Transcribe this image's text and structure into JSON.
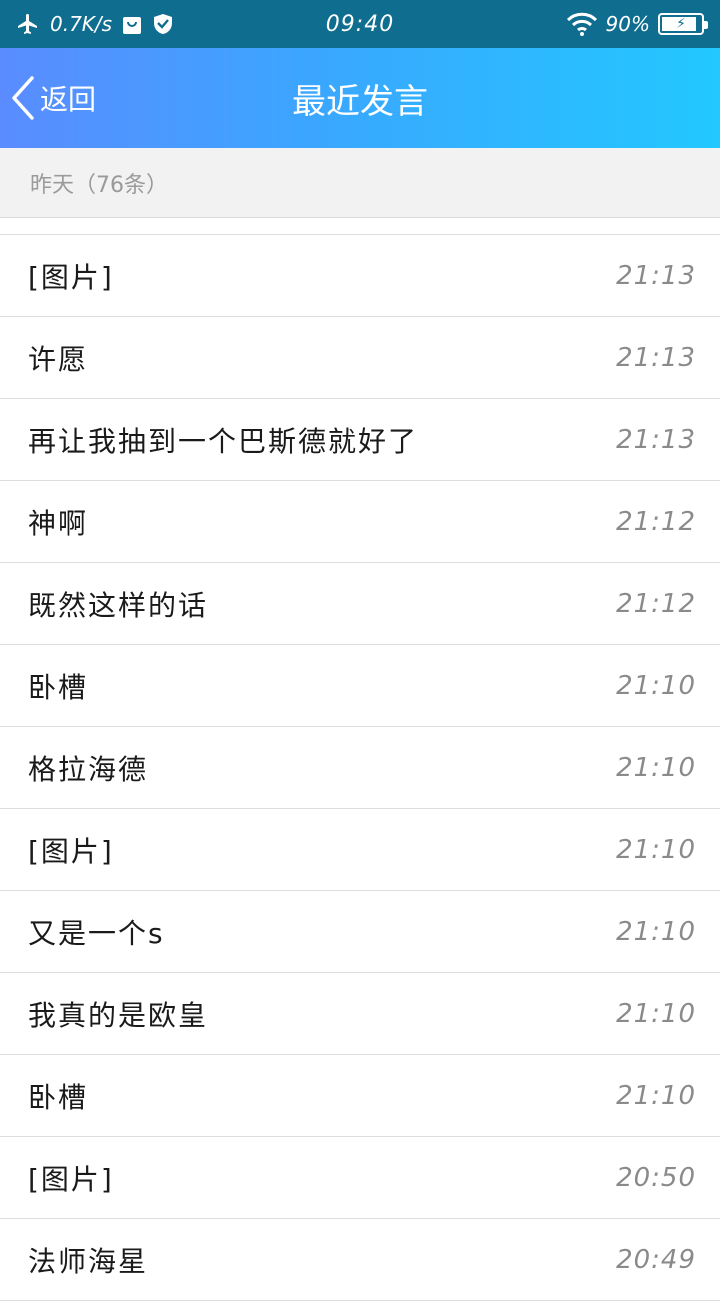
{
  "status_bar": {
    "net_speed": "0.7K/s",
    "time": "09:40",
    "battery": "90%",
    "battery_level": 0.9,
    "icons": [
      "airplane-icon",
      "bag-icon",
      "shield-icon",
      "wifi-icon",
      "battery-icon"
    ]
  },
  "nav": {
    "back_label": "返回",
    "title": "最近发言"
  },
  "section": {
    "header": "昨天（76条）"
  },
  "messages": [
    {
      "text": "[图片]",
      "time": "21:13"
    },
    {
      "text": "许愿",
      "time": "21:13"
    },
    {
      "text": "再让我抽到一个巴斯德就好了",
      "time": "21:13"
    },
    {
      "text": "神啊",
      "time": "21:12"
    },
    {
      "text": "既然这样的话",
      "time": "21:12"
    },
    {
      "text": "卧槽",
      "time": "21:10"
    },
    {
      "text": "格拉海德",
      "time": "21:10"
    },
    {
      "text": "[图片]",
      "time": "21:10"
    },
    {
      "text": "又是一个s",
      "time": "21:10"
    },
    {
      "text": "我真的是欧皇",
      "time": "21:10"
    },
    {
      "text": "卧槽",
      "time": "21:10"
    },
    {
      "text": "[图片]",
      "time": "20:50"
    },
    {
      "text": "法师海星",
      "time": "20:49"
    }
  ],
  "colors": {
    "status_bar": "#0f6e8f",
    "nav_gradient_start": "#5a8cff",
    "nav_gradient_end": "#22c8ff",
    "divider": "#dddddd"
  }
}
